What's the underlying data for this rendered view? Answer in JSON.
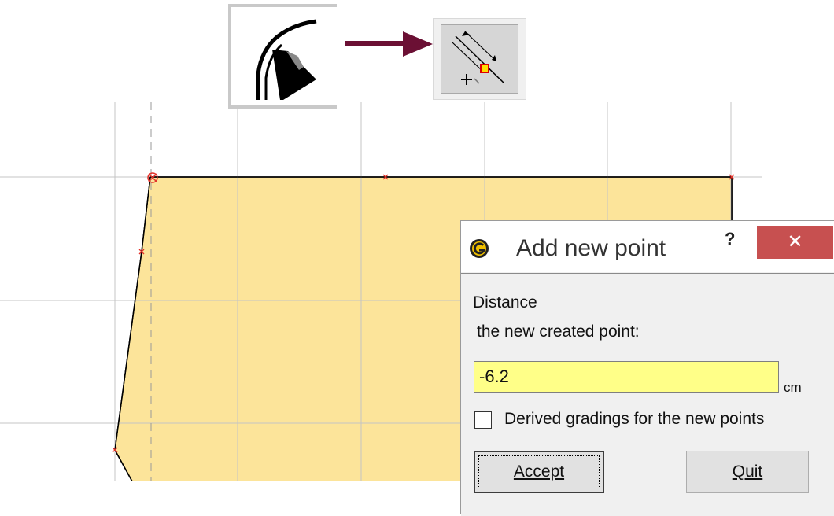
{
  "toolbar": {
    "arc_tool_icon": "arc-tool-icon",
    "arrow_icon": "right-arrow-icon",
    "add_point_tool_icon": "add-point-on-segment-icon",
    "arrow_color": "#6b1034"
  },
  "pattern": {
    "fill_color": "#fce49a",
    "stroke_color": "#000000",
    "point_marker_color": "#e3322a"
  },
  "dialog": {
    "title": "Add new point",
    "help_label": "?",
    "close_label": "✕",
    "close_color": "#c75050",
    "distance_label": "Distance",
    "created_point_label": "the new created point:",
    "distance_value": "-6.2",
    "unit": "cm",
    "derived_gradings_label": "Derived gradings for the new points",
    "derived_gradings_checked": false,
    "accept_label": "Accept",
    "quit_label": "Quit",
    "input_color": "#ffff88"
  }
}
